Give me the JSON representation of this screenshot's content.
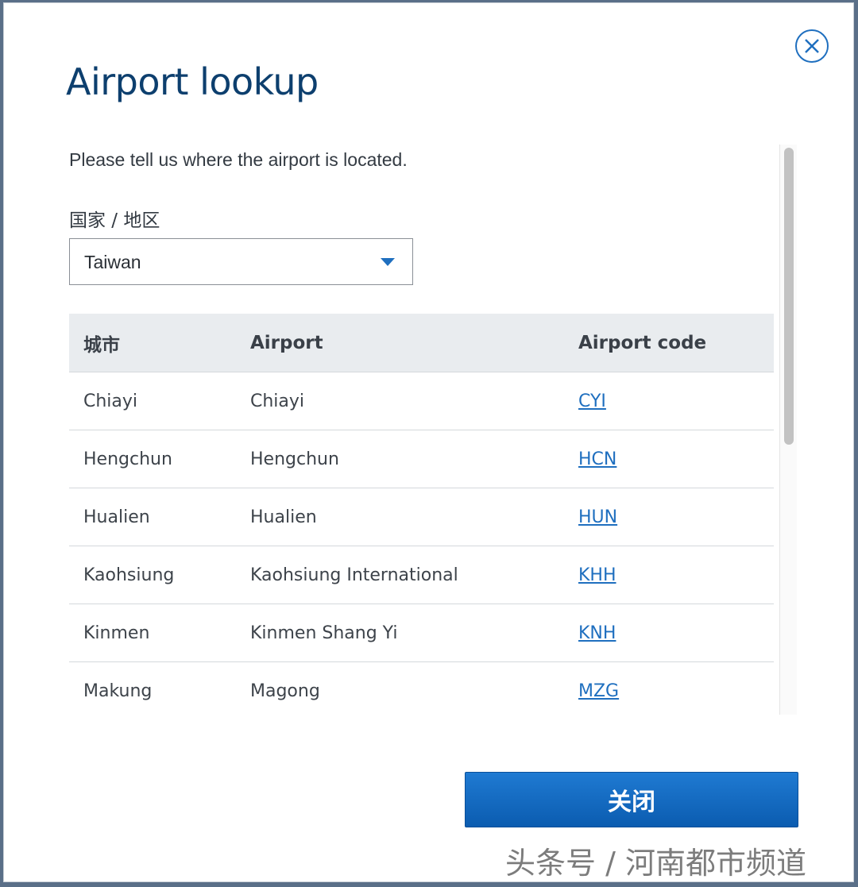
{
  "dialog": {
    "title": "Airport lookup",
    "close_icon": "close-circle-icon",
    "instructions": "Please tell us where the airport is located.",
    "country_label": "国家 / 地区",
    "country_selected": "Taiwan",
    "close_button_label": "关闭"
  },
  "table": {
    "headers": [
      "城市",
      "Airport",
      "Airport code"
    ],
    "rows": [
      {
        "city": "Chiayi",
        "airport": "Chiayi",
        "code": "CYI"
      },
      {
        "city": "Hengchun",
        "airport": "Hengchun",
        "code": "HCN"
      },
      {
        "city": "Hualien",
        "airport": "Hualien",
        "code": "HUN"
      },
      {
        "city": "Kaohsiung",
        "airport": "Kaohsiung International",
        "code": "KHH"
      },
      {
        "city": "Kinmen",
        "airport": "Kinmen Shang Yi",
        "code": "KNH"
      },
      {
        "city": "Makung",
        "airport": "Magong",
        "code": "MZG"
      }
    ]
  },
  "watermark": "头条号 / 河南都市频道",
  "colors": {
    "accent": "#1f6fbf",
    "title": "#0d3f6e",
    "header_bg": "#e9ecef",
    "button": "#0b63be"
  }
}
